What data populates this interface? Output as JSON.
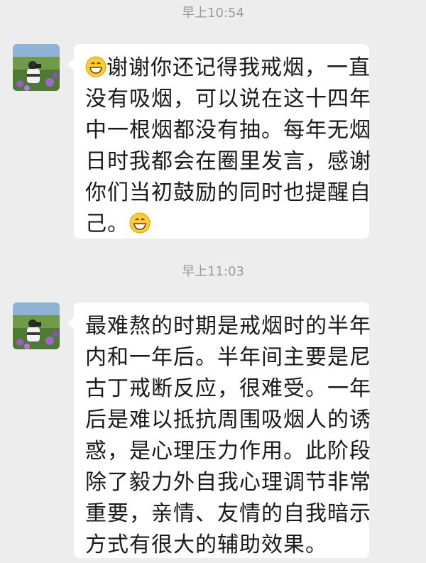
{
  "messages": [
    {
      "timestamp": "早上10:54",
      "lines": [
        "谢谢你还记得我戒烟，一直",
        "没有吸烟，可以说在这十四年",
        "中一根烟都没有抽。每年无烟",
        "日时我都会在圈里发言，感谢",
        "你们当初鼓励的同时也提醒自",
        "己。"
      ],
      "emoji": "grinning-face"
    },
    {
      "timestamp": "早上11:03",
      "lines": [
        "最难熬的时期是戒烟时的半年",
        "内和一年后。半年间主要是尼",
        "古丁戒断反应，很难受。一年",
        "后是难以抵抗周围吸烟人的诱",
        "惑，是心理压力作用。此阶段",
        "除了毅力外自我心理调节非常",
        "重要，亲情、友情的自我暗示",
        "方式有很大的辅助效果。"
      ]
    }
  ]
}
